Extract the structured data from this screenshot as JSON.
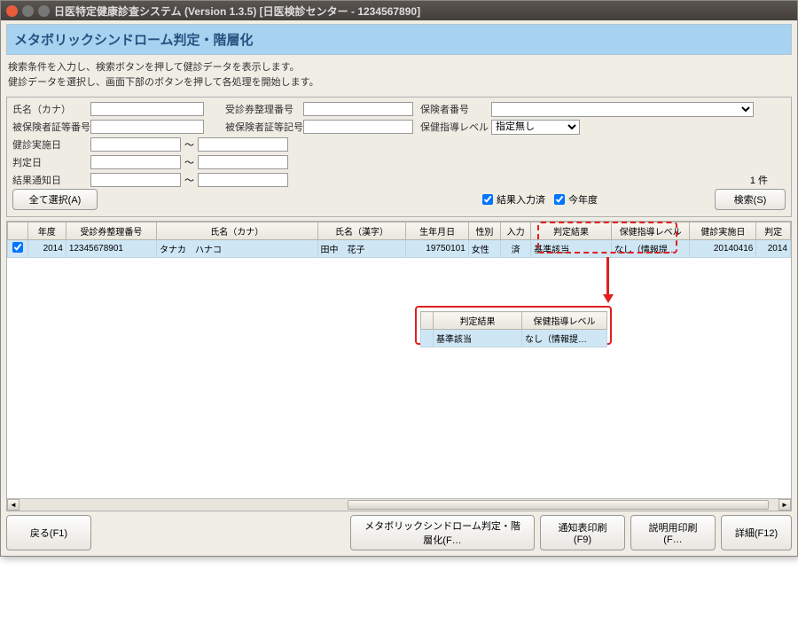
{
  "titlebar": {
    "text": "日医特定健康診査システム (Version 1.3.5) [日医検診センター - 1234567890]"
  },
  "subtitle": "メタボリックシンドローム判定・階層化",
  "instructions": {
    "line1": "検索条件を入力し、検索ボタンを押して健診データを表示します。",
    "line2": "健診データを選択し、画面下部のボタンを押して各処理を開始します。"
  },
  "search": {
    "labels": {
      "kana": "氏名（カナ）",
      "insured_no": "被保険者証等番号",
      "exam_date": "健診実施日",
      "judge_date": "判定日",
      "notify_date": "結果通知日",
      "ticket_no": "受診券整理番号",
      "insured_sym": "被保険者証等記号",
      "insurer_no": "保険者番号",
      "guidance_level": "保健指導レベル"
    },
    "guidance_default": "指定無し",
    "select_all_btn": "全て選択(A)",
    "search_btn": "検索(S)",
    "result_done_chk": "結果入力済",
    "this_year_chk": "今年度",
    "count_suffix": "件",
    "count_value": "1"
  },
  "table": {
    "headers": {
      "chk": "",
      "year": "年度",
      "ticket": "受診券整理番号",
      "kana": "氏名（カナ）",
      "kanji": "氏名（漢字）",
      "birth": "生年月日",
      "sex": "性別",
      "input": "入力",
      "result": "判定結果",
      "level": "保健指導レベル",
      "exam_date": "健診実施日",
      "judge": "判定"
    },
    "row": {
      "year": "2014",
      "ticket": "12345678901",
      "kana": "タナカ　ハナコ",
      "kanji": "田中　花子",
      "birth": "19750101",
      "sex": "女性",
      "input": "済",
      "result": "基準該当",
      "level": "なし（情報提…",
      "exam_date": "20140416",
      "judge": "2014"
    }
  },
  "popup": {
    "headers": {
      "result": "判定結果",
      "level": "保健指導レベル"
    },
    "row": {
      "result": "基準該当",
      "level": "なし（情報提…"
    }
  },
  "bottom": {
    "back": "戻る(F1)",
    "main": "メタボリックシンドローム判定・階層化(F…",
    "notify": "通知表印刷(F9)",
    "explain": "説明用印刷(F…",
    "detail": "詳細(F12)"
  }
}
